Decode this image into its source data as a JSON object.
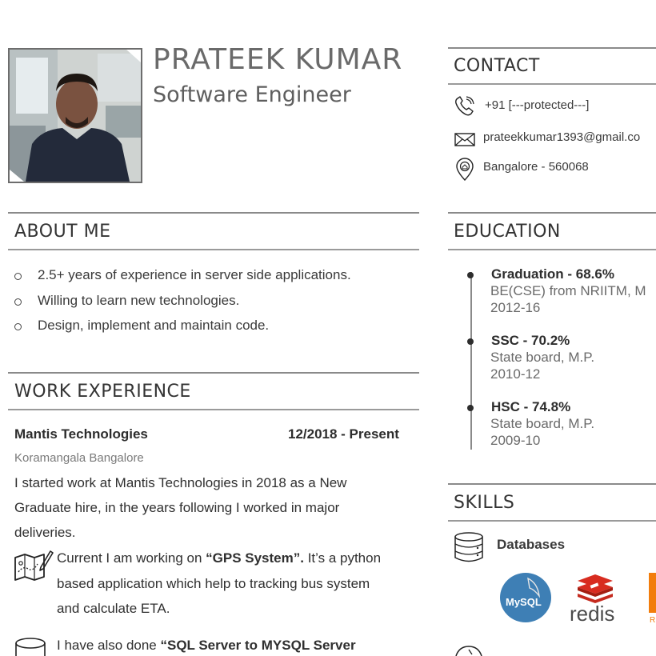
{
  "header": {
    "name": "PRATEEK KUMAR",
    "title": "Software Engineer"
  },
  "about": {
    "heading": "ABOUT ME",
    "items": [
      "2.5+ years of experience in server side applications.",
      "Willing to learn new technologies.",
      "Design, implement and maintain code."
    ]
  },
  "work": {
    "heading": "WORK EXPERIENCE",
    "company": "Mantis Technologies",
    "dates": "12/2018 - Present",
    "location": "Koramangala Bangalore",
    "summary_lines": [
      "I started work at Mantis Technologies in 2018 as a New",
      "Graduate hire, in the years following I worked in major",
      "deliveries."
    ],
    "projects": [
      {
        "icon": "map-icon",
        "line1_prefix": "Current I am working on ",
        "line1_bold": "“GPS System”.",
        "line1_suffix": " It’s a python",
        "line2": "based application which help to tracking bus system",
        "line3": "and calculate ETA."
      },
      {
        "icon": "database-icon",
        "line1_prefix": "I have also done ",
        "line1_bold": "“SQL Server to MYSQL Server"
      }
    ]
  },
  "contact": {
    "heading": "CONTACT",
    "phone": "+91 [---protected---]",
    "email": "prateekkumar1393@gmail.co",
    "address": "Bangalore - 560068",
    "icons": [
      "phone-icon",
      "mail-icon",
      "location-icon"
    ]
  },
  "education": {
    "heading": "EDUCATION",
    "items": [
      {
        "degree": "Graduation - 68.6%",
        "institution": "BE(CSE) from NRIITM, M",
        "years": "2012-16"
      },
      {
        "degree": "SSC - 70.2%",
        "institution": "State board, M.P.",
        "years": "2010-12"
      },
      {
        "degree": "HSC - 74.8%",
        "institution": "State board, M.P.",
        "years": "2009-10"
      }
    ]
  },
  "skills": {
    "heading": "SKILLS",
    "categories": [
      {
        "label": "Databases",
        "icon": "database-icon",
        "logos": [
          "MySQL",
          "redis",
          "R"
        ]
      }
    ]
  },
  "colors": {
    "rule": "#8a8a8a",
    "mysql": "#3e7fb5",
    "redis": "#d82c20",
    "orange": "#f27d0c"
  }
}
